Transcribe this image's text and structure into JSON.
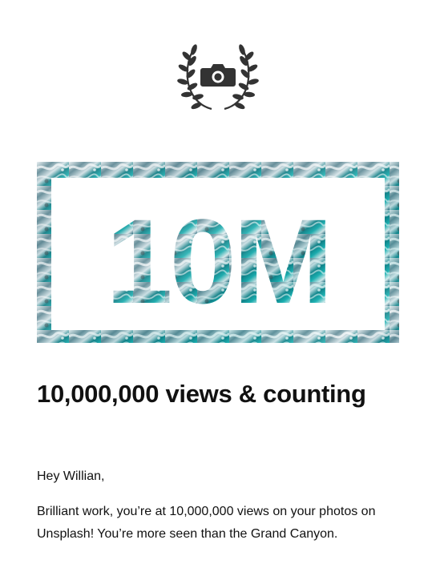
{
  "email": {
    "logo_icon": "camera-laurel-icon",
    "banner": {
      "text": "10M",
      "frame_color": "#ffffff",
      "image_colors": [
        "#0e5c6a",
        "#1aa3a6",
        "#e9f1f2",
        "#3a3a36"
      ]
    },
    "headline": "10,000,000 views & counting",
    "greeting": "Hey Willian,",
    "body": "Brilliant work, you’re at 10,000,000 views on your photos on Unsplash! You’re more seen than the Grand Canyon."
  }
}
